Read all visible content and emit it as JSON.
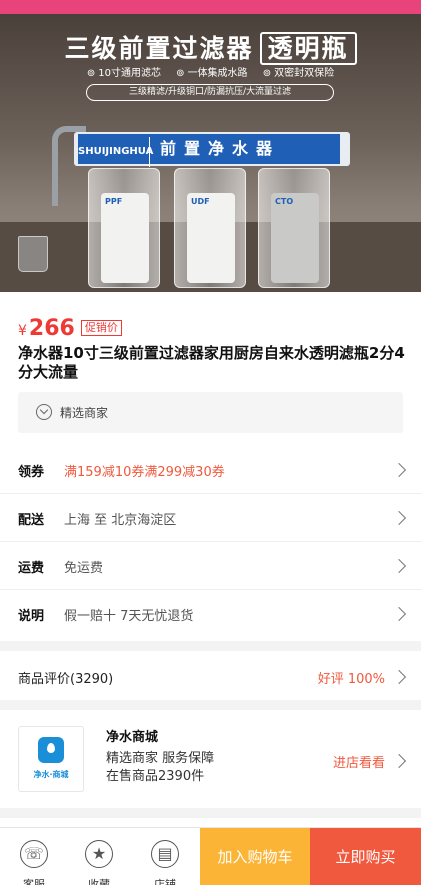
{
  "hero": {
    "headline": "三级前置过滤器",
    "headline_badge": "透明瓶",
    "features": [
      "10寸通用滤芯",
      "一体集成水路",
      "双密封双保险"
    ],
    "tagline": "三级精滤/升级铜口/防漏抗压/大流量过滤",
    "bracket_brand": "SHUIJINGHUA",
    "bracket_title": "前置净水器",
    "cartridge_labels": [
      "PPF",
      "UDF",
      "CTO"
    ]
  },
  "price": {
    "currency": "¥",
    "amount": "266",
    "promo_tag": "促销价"
  },
  "product": {
    "title": "净水器10寸三级前置过滤器家用厨房自来水透明滤瓶2分4分大流量"
  },
  "merchant": {
    "label": "精选商家"
  },
  "info_rows": [
    {
      "label": "领券",
      "value": "满159减10券满299减30券"
    },
    {
      "label": "配送",
      "value": "上海 至 北京海淀区"
    },
    {
      "label": "运费",
      "value": "免运费"
    },
    {
      "label": "说明",
      "value": "假一赔十 7天无忧退货"
    }
  ],
  "reviews": {
    "label": "商品评价(3290)",
    "rating": "好评 100%"
  },
  "store": {
    "logo_text": "净水·商城",
    "name": "净水商城",
    "line1": "精选商家 服务保障",
    "line2": "在售商品2390件",
    "visit": "进店看看"
  },
  "bottom_bar": {
    "nav": [
      {
        "label": "客服",
        "icon": "customer-service-icon"
      },
      {
        "label": "收藏",
        "icon": "star-icon"
      },
      {
        "label": "店铺",
        "icon": "shop-icon"
      }
    ],
    "add_to_cart": "加入购物车",
    "buy_now": "立即购买"
  },
  "colors": {
    "accent": "#f0593e",
    "price_red": "#ee3a35",
    "cart_yellow": "#fcb437",
    "top_bar": "#e8437b"
  }
}
